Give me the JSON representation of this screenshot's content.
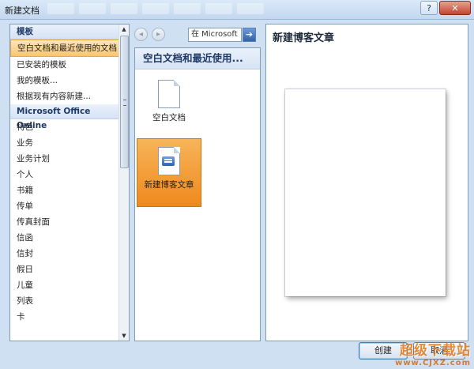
{
  "window": {
    "title": "新建文档",
    "help_label": "?",
    "close_label": "✕"
  },
  "left": {
    "section_templates": "模板",
    "items": [
      "空白文档和最近使用的文档",
      "已安装的模板",
      "我的模板...",
      "根据现有内容新建..."
    ],
    "section_online": "Microsoft Office Online",
    "online_items": [
      "特色",
      "业务",
      "业务计划",
      "个人",
      "书籍",
      "传单",
      "传真封面",
      "信函",
      "信封",
      "假日",
      "儿童",
      "列表",
      "卡"
    ]
  },
  "nav": {
    "back_icon": "◂",
    "forward_icon": "▸",
    "search_placeholder": "在 Microsoft",
    "search_value": "在 Microsoft",
    "go_icon": "➔"
  },
  "middle": {
    "header": "空白文档和最近使用...",
    "tiles": [
      {
        "label": "空白文档",
        "icon": "blank-document-icon"
      },
      {
        "label": "新建博客文章",
        "icon": "blog-post-icon",
        "selected": true
      }
    ]
  },
  "right": {
    "title": "新建博客文章"
  },
  "buttons": {
    "create": "创建",
    "cancel": "取消"
  },
  "watermark": {
    "line1": "超级下载站",
    "line2": "www.CJXZ.com"
  },
  "colors": {
    "accent_selected": "#f4a43c",
    "panel_border": "#7f9db9",
    "header_text": "#1e3a66"
  }
}
